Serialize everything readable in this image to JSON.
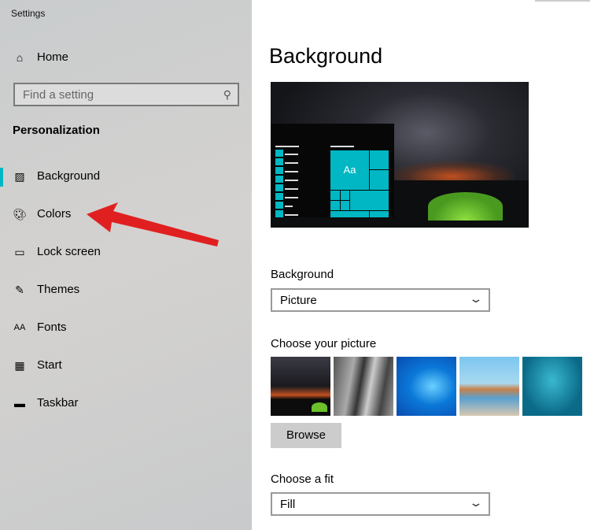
{
  "window": {
    "title": "Settings"
  },
  "sidebar": {
    "home": "Home",
    "search_placeholder": "Find a setting",
    "section": "Personalization",
    "items": [
      {
        "label": "Background",
        "icon": "picture-icon",
        "selected": true
      },
      {
        "label": "Colors",
        "icon": "palette-icon"
      },
      {
        "label": "Lock screen",
        "icon": "lock-screen-icon"
      },
      {
        "label": "Themes",
        "icon": "themes-icon"
      },
      {
        "label": "Fonts",
        "icon": "fonts-icon"
      },
      {
        "label": "Start",
        "icon": "start-icon"
      },
      {
        "label": "Taskbar",
        "icon": "taskbar-icon"
      }
    ]
  },
  "main": {
    "title": "Background",
    "preview_tile_text": "Aa",
    "background_label": "Background",
    "background_value": "Picture",
    "choose_picture_label": "Choose your picture",
    "browse_label": "Browse",
    "fit_label": "Choose a fit",
    "fit_value": "Fill"
  },
  "colors": {
    "accent": "#00b7c3",
    "arrow": "#e02020"
  }
}
